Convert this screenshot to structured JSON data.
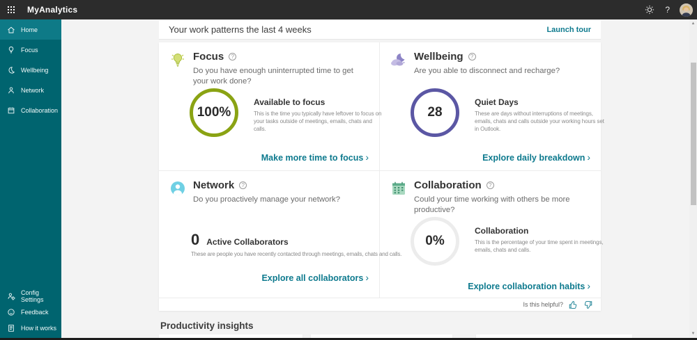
{
  "topbar": {
    "app_title": "MyAnalytics"
  },
  "sidebar": {
    "items": [
      {
        "label": "Home",
        "icon": "home-icon",
        "active": true
      },
      {
        "label": "Focus",
        "icon": "lightbulb-icon",
        "active": false
      },
      {
        "label": "Wellbeing",
        "icon": "moon-icon",
        "active": false
      },
      {
        "label": "Network",
        "icon": "person-icon",
        "active": false
      },
      {
        "label": "Collaboration",
        "icon": "calendar-icon",
        "active": false
      }
    ],
    "footer_items": [
      {
        "label": "Config Settings",
        "icon": "settings-person-icon"
      },
      {
        "label": "Feedback",
        "icon": "smiley-icon"
      },
      {
        "label": "How it works",
        "icon": "document-icon"
      }
    ]
  },
  "header": {
    "title": "Your work patterns the last 4 weeks",
    "action_label": "Launch tour"
  },
  "cards": {
    "focus": {
      "title": "Focus",
      "question": "Do you have enough uninterrupted time to get your work done?",
      "value": "100%",
      "stat_label": "Available to focus",
      "stat_desc": "This is the time you typically have leftover to focus on your tasks outside of meetings, emails, chats and calls.",
      "link_label": "Make more time to focus"
    },
    "wellbeing": {
      "title": "Wellbeing",
      "question": "Are you able to disconnect and recharge?",
      "value": "28",
      "stat_label": "Quiet Days",
      "stat_desc": "These are days without interruptions of meetings, emails, chats and calls outside your working hours set in Outlook.",
      "link_label": "Explore daily breakdown"
    },
    "network": {
      "title": "Network",
      "question": "Do you proactively manage your network?",
      "value": "0",
      "stat_label": "Active Collaborators",
      "stat_desc": "These are people you have recently contacted through meetings, emails, chats and calls.",
      "link_label": "Explore all collaborators"
    },
    "collaboration": {
      "title": "Collaboration",
      "question": "Could your time working with others be more productive?",
      "value": "0%",
      "stat_label": "Collaboration",
      "stat_desc": "This is the percentage of your time spent in meetings, emails, chats and calls.",
      "link_label": "Explore collaboration habits"
    }
  },
  "card_footer": {
    "helpful_label": "Is this helpful?"
  },
  "insights_section": {
    "title": "Productivity insights"
  },
  "colors": {
    "topbar": "#2c2c2c",
    "sidebar": "#00646f",
    "sidebar_active": "#0e7a87",
    "accent_teal": "#0e7a8e",
    "focus_ring": "#8aa313",
    "wellbeing_ring": "#5b57a4",
    "collaboration_ring": "#ececec"
  }
}
